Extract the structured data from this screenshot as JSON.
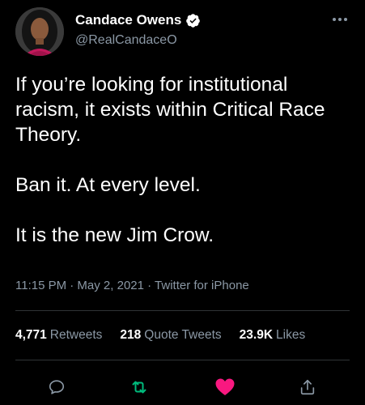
{
  "author": {
    "name": "Candace Owens",
    "handle": "@RealCandaceO",
    "verified": true
  },
  "tweet": {
    "paragraphs": [
      "If you’re looking for institutional racism, it exists within Critical Race Theory.",
      "Ban it. At every level.",
      "It is the new Jim Crow."
    ],
    "meta": "11:15 PM · May 2, 2021 · Twitter for iPhone"
  },
  "stats": {
    "retweets_count": "4,771",
    "retweets_label": "Retweets",
    "quotes_count": "218",
    "quotes_label": "Quote Tweets",
    "likes_count": "23.9K",
    "likes_label": "Likes"
  },
  "actions": {
    "reply_icon": "reply-icon",
    "retweet_icon": "retweet-icon",
    "like_icon": "heart-icon",
    "share_icon": "share-icon",
    "retweet_color": "#00ba7c",
    "like_color": "#f91880",
    "liked": true
  },
  "colors": {
    "background": "#000000",
    "text_primary": "#ffffff",
    "text_secondary": "#8b98a5",
    "divider": "#2f3336",
    "verified_badge": "#ffffff"
  }
}
